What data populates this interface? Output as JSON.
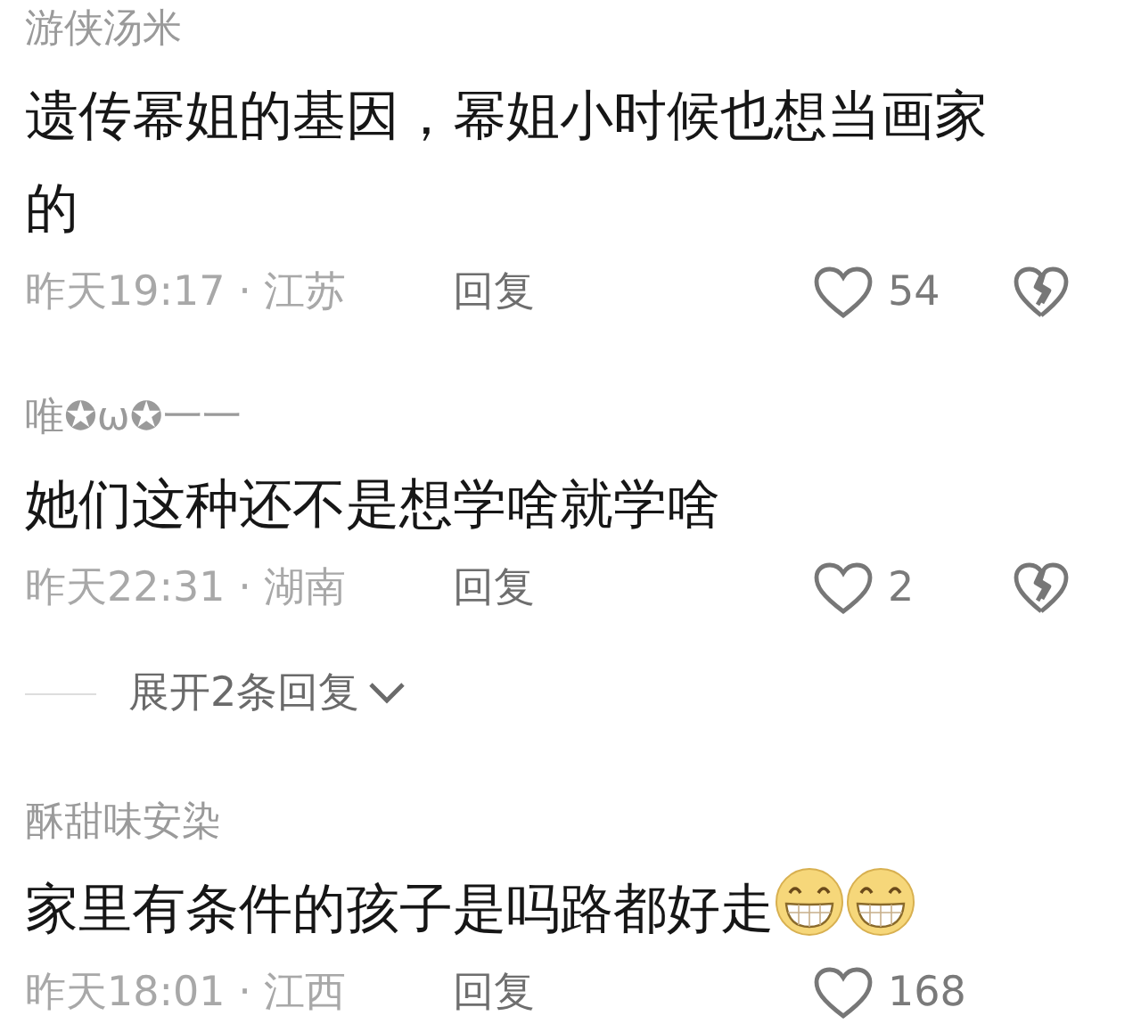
{
  "comments": [
    {
      "username": "游侠汤米",
      "text": "遗传幂姐的基因，幂姐小时候也想当画家的",
      "meta": "昨天19:17 · 江苏",
      "reply": "回复",
      "likes": "54",
      "dislike_button": true
    },
    {
      "username": "唯✪ω✪一一",
      "text": "她们这种还不是想学啥就学啥",
      "meta": "昨天22:31 · 湖南",
      "reply": "回复",
      "likes": "2",
      "dislike_button": true,
      "replies_toggle": {
        "label": "展开2条回复"
      }
    },
    {
      "username": "酥甜味安染",
      "text": "家里有条件的孩子是吗路都好走",
      "emojis": [
        {
          "kind": "grin"
        },
        {
          "kind": "grin"
        }
      ],
      "meta": "昨天18:01 · 江西",
      "reply": "回复",
      "likes": "168",
      "dislike_button": false
    }
  ]
}
